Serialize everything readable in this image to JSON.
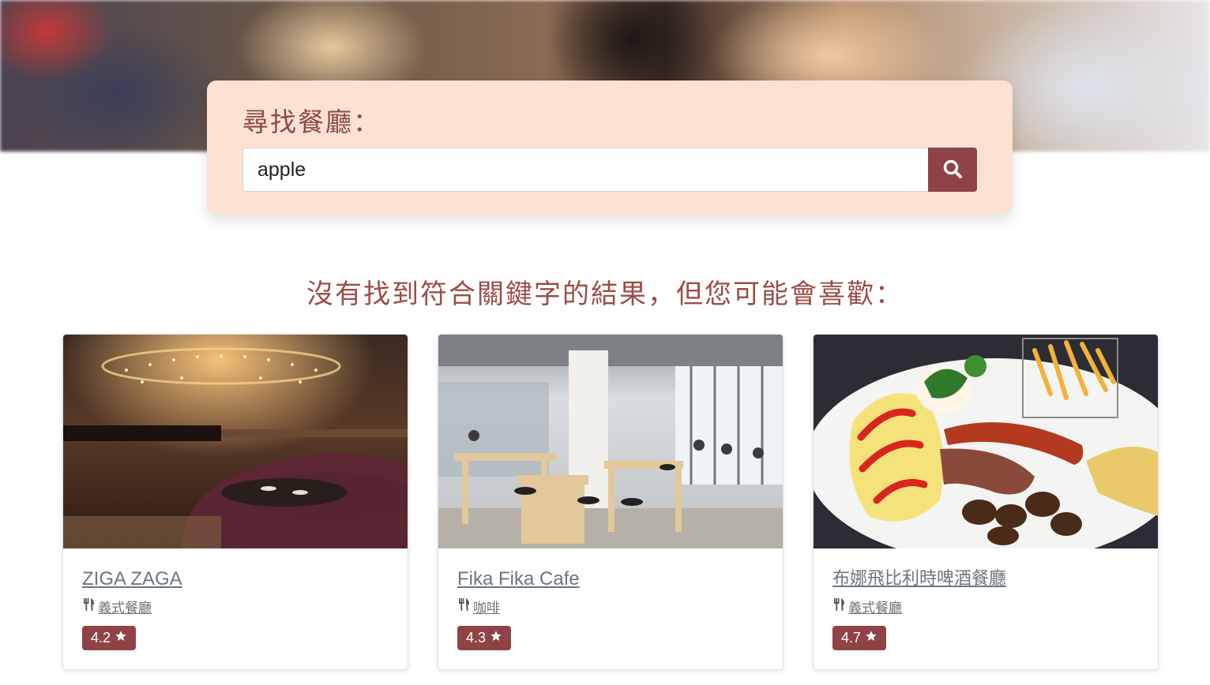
{
  "search": {
    "title": "尋找餐廳：",
    "value": "apple",
    "button_icon": "search-icon"
  },
  "heading": "沒有找到符合關鍵字的結果，但您可能會喜歡：",
  "colors": {
    "accent": "#8f4346",
    "search_card_bg": "#fde1d3",
    "heading_text": "#9b4d49"
  },
  "restaurants": [
    {
      "name": "ZIGA ZAGA",
      "category": "義式餐廳",
      "category_icon": "utensils-icon",
      "rating": "4.2",
      "rating_icon": "star-icon"
    },
    {
      "name": "Fika Fika Cafe",
      "category": "咖啡",
      "category_icon": "utensils-icon",
      "rating": "4.3",
      "rating_icon": "star-icon"
    },
    {
      "name": "布娜飛比利時啤酒餐廳",
      "category": "義式餐廳",
      "category_icon": "utensils-icon",
      "rating": "4.7",
      "rating_icon": "star-icon"
    }
  ]
}
